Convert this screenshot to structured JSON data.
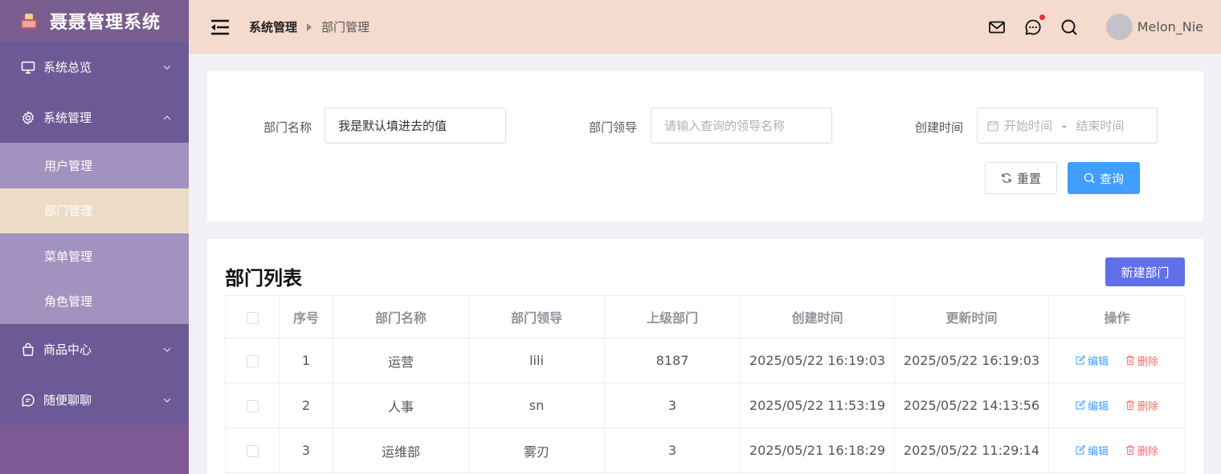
{
  "app": {
    "title": "聂聂管理系统"
  },
  "sidebar": {
    "items": [
      {
        "label": "系统总览",
        "icon": "monitor-icon",
        "expanded": false
      },
      {
        "label": "系统管理",
        "icon": "gear-icon",
        "expanded": true,
        "children": [
          {
            "label": "用户管理",
            "active": false
          },
          {
            "label": "部门管理",
            "active": true
          },
          {
            "label": "菜单管理",
            "active": false
          },
          {
            "label": "角色管理",
            "active": false
          }
        ]
      },
      {
        "label": "商品中心",
        "icon": "shopping-bag-icon",
        "expanded": false
      },
      {
        "label": "随便聊聊",
        "icon": "chat-icon",
        "expanded": false
      }
    ]
  },
  "header": {
    "breadcrumb": [
      "系统管理",
      "部门管理"
    ],
    "username": "Melon_Nie"
  },
  "search": {
    "dept_name_label": "部门名称",
    "dept_name_value": "我是默认填进去的值",
    "leader_label": "部门领导",
    "leader_placeholder": "请输入查询的领导名称",
    "time_label": "创建时间",
    "start_placeholder": "开始时间",
    "end_placeholder": "结束时间",
    "range_separator": "-",
    "reset_label": "重置",
    "query_label": "查询"
  },
  "list": {
    "title": "部门列表",
    "new_label": "新建部门",
    "columns": [
      "序号",
      "部门名称",
      "部门领导",
      "上级部门",
      "创建时间",
      "更新时间",
      "操作"
    ],
    "rows": [
      {
        "index": "1",
        "name": "运营",
        "leader": "lili",
        "parent": "8187",
        "created": "2025/05/22 16:19:03",
        "updated": "2025/05/22 16:19:03"
      },
      {
        "index": "2",
        "name": "人事",
        "leader": "sn",
        "parent": "3",
        "created": "2025/05/22 11:53:19",
        "updated": "2025/05/22 14:13:56"
      },
      {
        "index": "3",
        "name": "运维部",
        "leader": "雾刃",
        "parent": "3",
        "created": "2025/05/21 16:18:29",
        "updated": "2025/05/22 11:29:14"
      }
    ],
    "edit_label": "编辑",
    "delete_label": "删除"
  },
  "colors": {
    "sidebar_bg": "#6c5a96",
    "submenu_bg": "#a292bf",
    "submenu_active_bg": "#ecdcc6",
    "header_bg": "#f5dbcd",
    "primary": "#409eff",
    "new_button": "#6070e8",
    "danger": "#f56c6c"
  }
}
